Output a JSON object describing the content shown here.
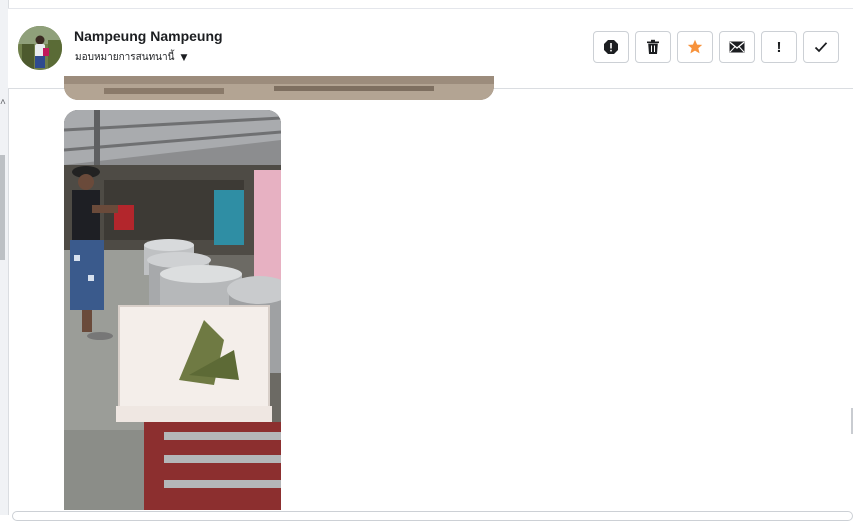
{
  "conversation": {
    "contact_name": "Nampeung Nampeung",
    "assign_label": "มอบหมายการสนทนานี้"
  },
  "actions": [
    {
      "name": "spam-icon"
    },
    {
      "name": "trash-icon"
    },
    {
      "name": "star-icon"
    },
    {
      "name": "envelope-icon"
    },
    {
      "name": "exclamation-icon",
      "glyph": "!"
    },
    {
      "name": "check-icon"
    }
  ],
  "colors": {
    "star": "#f7923b",
    "border": "#ccd0d5",
    "text": "#1c1e21"
  }
}
